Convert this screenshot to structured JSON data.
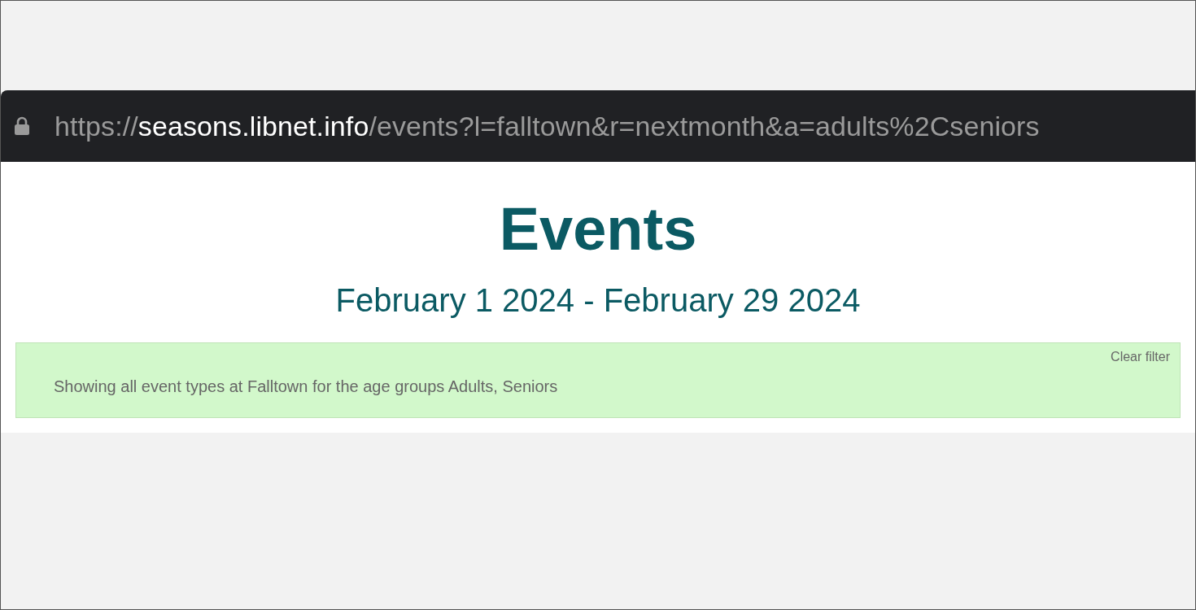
{
  "address_bar": {
    "scheme": "https://",
    "host": "seasons.libnet.info",
    "path": "/events?l=falltown&r=nextmonth&a=adults%2Cseniors",
    "secure": true
  },
  "page": {
    "title": "Events",
    "date_range": "February 1 2024 - February 29 2024"
  },
  "filter_notice": {
    "clear_link": "Clear filter",
    "message": "Showing all event types at Falltown for the age groups Adults, Seniors"
  }
}
